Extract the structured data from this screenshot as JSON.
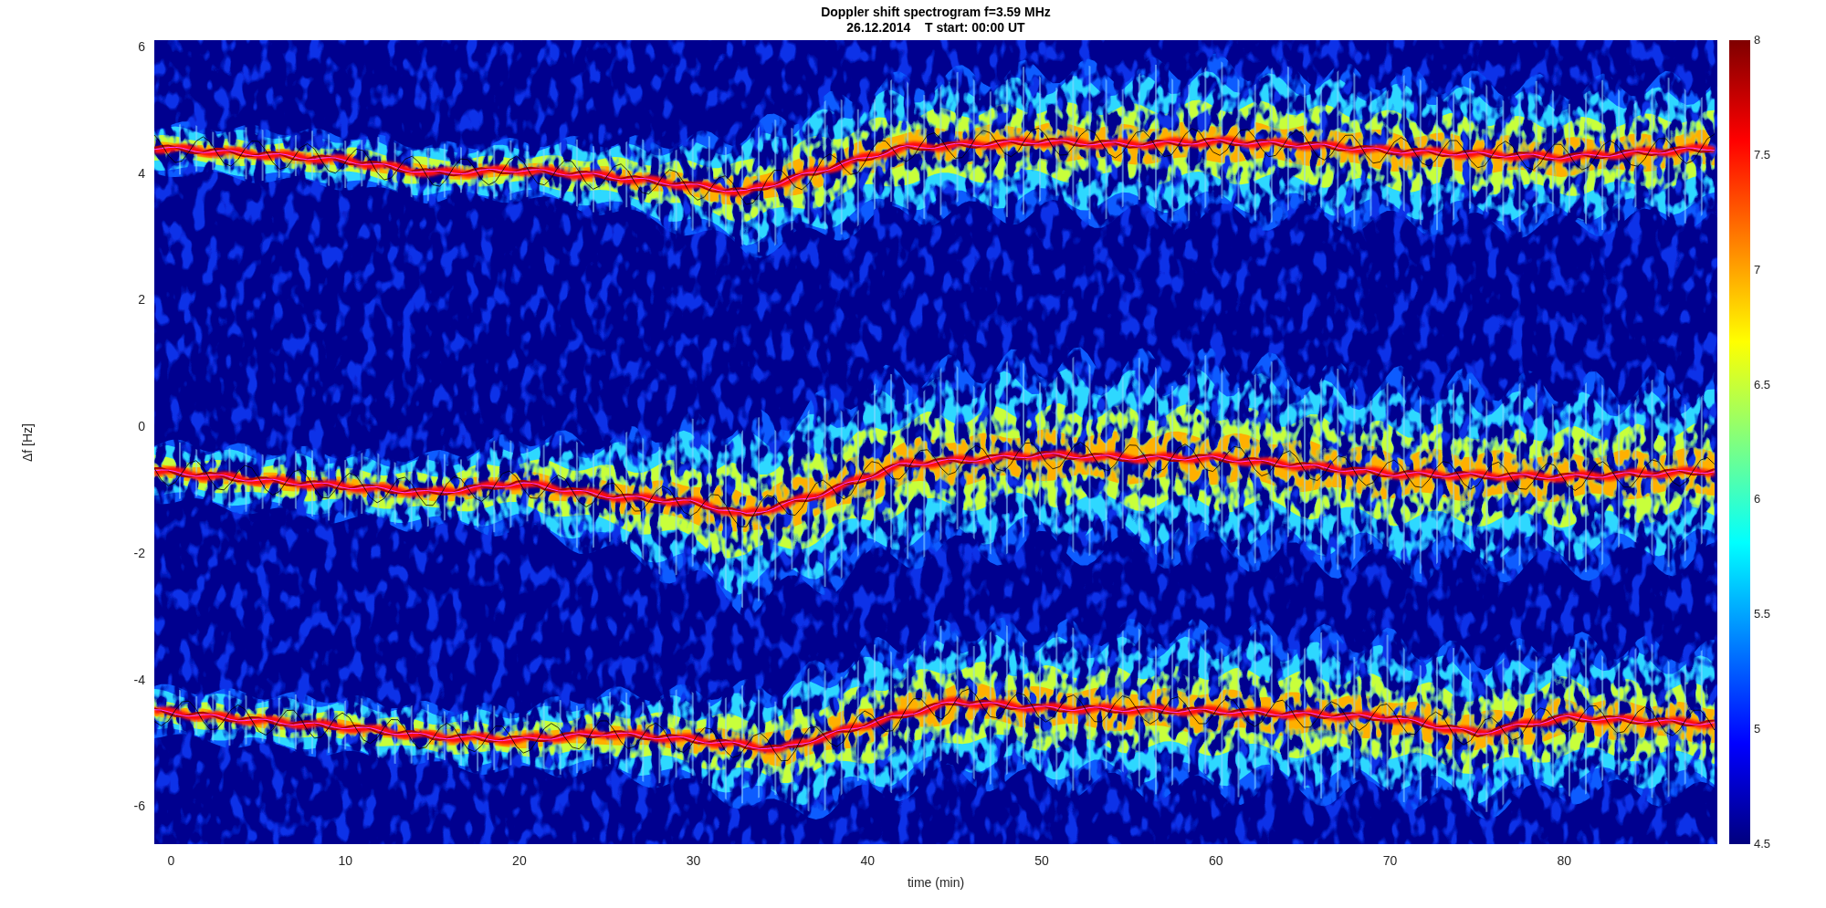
{
  "figure": {
    "title": "Doppler shift spectrogram f=3.59 MHz",
    "subtitle": "26.12.2014    T start: 00:00 UT",
    "axes": {
      "xlabel": "time (min)",
      "ylabel": "Δf [Hz]",
      "xtick_labels": [
        "0",
        "10",
        "20",
        "30",
        "40",
        "50",
        "60",
        "70",
        "80"
      ],
      "ytick_labels": [
        "6",
        "4",
        "2",
        "0",
        "-2",
        "-4",
        "-6"
      ]
    },
    "colorbar": {
      "tick_labels": [
        "8",
        "7.5",
        "7",
        "6.5",
        "6",
        "5.5",
        "5",
        "4.5"
      ]
    }
  }
}
